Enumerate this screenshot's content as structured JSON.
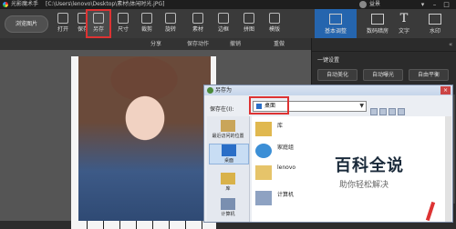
{
  "titlebar": {
    "app_name": "光影魔术手",
    "file_path": "[C:\\Users\\lenovo\\Desktop\\素材\\体闲时光.jPG]",
    "username": "益景",
    "controls": [
      "▾",
      "–",
      "□",
      "×"
    ]
  },
  "toolbar": {
    "browse_label": "浏览图片",
    "tools": [
      {
        "label": "打开",
        "icon": "open-icon"
      },
      {
        "label": "保存",
        "icon": "save-icon"
      },
      {
        "label": "另存",
        "icon": "save-as-icon",
        "selected": true
      },
      {
        "label": "尺寸",
        "icon": "resize-icon"
      },
      {
        "label": "裁剪",
        "icon": "crop-icon"
      },
      {
        "label": "旋转",
        "icon": "rotate-icon"
      },
      {
        "label": "素材",
        "icon": "material-icon"
      },
      {
        "label": "边框",
        "icon": "frame-icon"
      },
      {
        "label": "拼图",
        "icon": "collage-icon"
      },
      {
        "label": "模版",
        "icon": "template-icon"
      }
    ],
    "right_tabs": [
      {
        "label": "基本调整",
        "icon": "adjust-icon",
        "active": true
      },
      {
        "label": "数码暗房",
        "icon": "darkroom-icon"
      },
      {
        "label": "文字",
        "icon": "text-icon",
        "glyph": "T"
      },
      {
        "label": "水印",
        "icon": "watermark-icon"
      }
    ]
  },
  "subbar": {
    "share": "分享",
    "save_action": "保存动作",
    "undo": "撤销",
    "redo": "重做"
  },
  "sidebar": {
    "section": "一键设置",
    "buttons": [
      "自动美化",
      "自动曝光",
      "自由平衡"
    ]
  },
  "dialog": {
    "title": "另存为",
    "save_in_label": "保存在(I):",
    "location": "桌面",
    "places": [
      "最近访问的位置",
      "桌面",
      "库",
      "计算机"
    ],
    "items": [
      {
        "name": "库",
        "sub": ""
      },
      {
        "name": "家庭组",
        "sub": ""
      },
      {
        "name": "lenovo",
        "sub": ""
      },
      {
        "name": "计算机",
        "sub": ""
      }
    ]
  },
  "watermark": {
    "line1": "百科全说",
    "line2": "助你轻松解决"
  }
}
